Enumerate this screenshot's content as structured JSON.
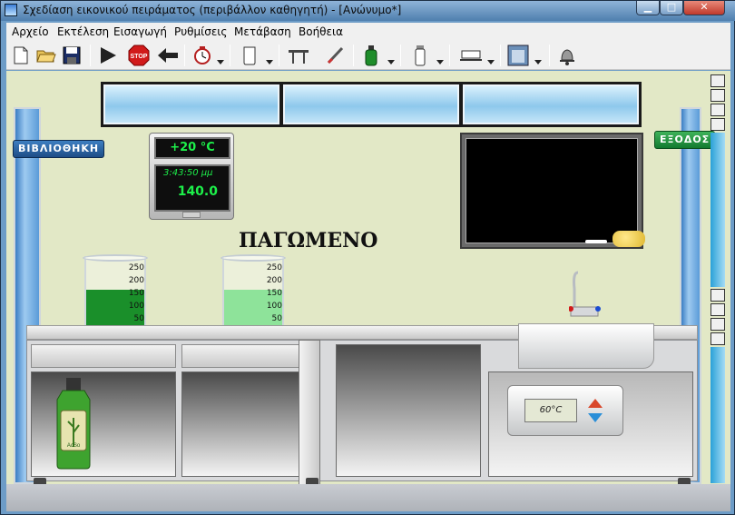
{
  "window": {
    "title": "Σχεδίαση εικονικού πειράματος (περιβάλλον καθηγητή) - [Ανώνυμο*]",
    "close_glyph": "✕",
    "min_glyph": "▁",
    "max_glyph": "□"
  },
  "menu": {
    "items": [
      "Αρχείο",
      "Εκτέλεση",
      "Εισαγωγή",
      "Ρυθμίσεις",
      "Μετάβαση",
      "Βοήθεια"
    ]
  },
  "toolbar": {
    "icons": [
      "new-file-icon",
      "open-folder-icon",
      "save-icon",
      "play-icon",
      "stop-icon",
      "back-arrow-icon",
      "timer-icon",
      "beaker-icon",
      "table-icon",
      "rod-icon",
      "bottle-icon",
      "tube-icon",
      "dish-icon",
      "image-icon",
      "bell-icon"
    ],
    "stop_label": "STOP"
  },
  "lab": {
    "library_label": "ΒΙΒΛΙΟΘΗΚΗ",
    "exit_label": "ΕΞΟΔΟΣ",
    "thermometer_reading": "+20 °C",
    "clock_time": "3:43:50 μμ",
    "clock_value": "140.0",
    "state_label": "ΠΑΓΩΜΕΝΟ",
    "heater_reading": "60°C",
    "beakers": [
      {
        "ticks": [
          "250",
          "200",
          "150",
          "100",
          "50"
        ],
        "fill_level": 0.55,
        "color": "#1a8f2a"
      },
      {
        "ticks": [
          "250",
          "200",
          "150",
          "100",
          "50"
        ],
        "fill_level": 0.55,
        "color": "#8ee39a"
      }
    ],
    "bottle_label": "AcSo"
  },
  "colors": {
    "wall": "#e2e8c6",
    "blackboard": "#000000",
    "display_green": "#1df04a",
    "library_blue": "#1d4d86",
    "exit_green": "#127a2f"
  }
}
